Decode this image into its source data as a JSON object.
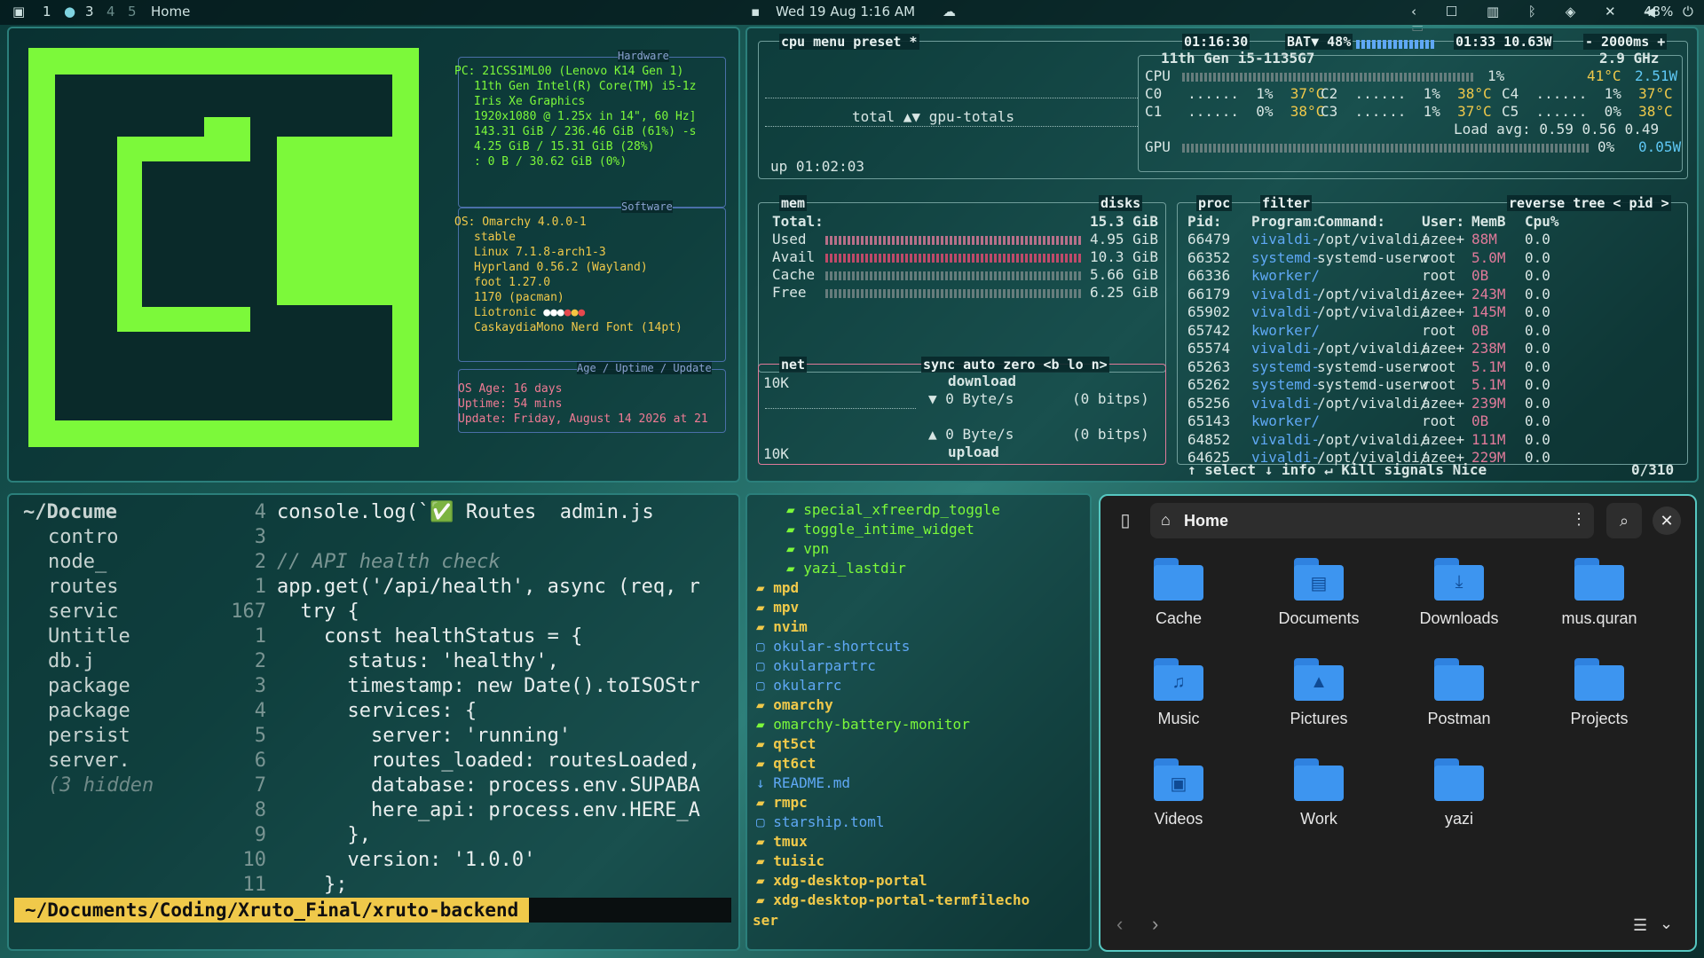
{
  "topbar": {
    "workspaces": [
      "1",
      "2",
      "3",
      "4",
      "5"
    ],
    "active_label": "Home",
    "clock": "Wed 19 Aug 1:16 AM",
    "battery": "48%"
  },
  "fetch": {
    "hardware_title": "Hardware",
    "hardware": [
      "PC: 21CSS1ML00 (Lenovo K14 Gen 1)",
      "11th Gen Intel(R) Core(TM) i5-1z",
      "Iris Xe Graphics",
      "1920x1080 @ 1.25x in 14\", 60 Hz]",
      "143.31 GiB / 236.46 GiB (61%) -s",
      "4.25 GiB / 15.31 GiB (28%)",
      ": 0 B / 30.62 GiB (0%)"
    ],
    "software_title": "Software",
    "software": [
      "OS: Omarchy 4.0.0-1",
      "stable",
      "Linux 7.1.8-arch1-3",
      "Hyprland 0.56.2 (Wayland)",
      "foot 1.27.0",
      "1170 (pacman)",
      "Liotronic",
      "CaskaydiaMono Nerd Font (14pt)"
    ],
    "age_title": "Age / Uptime / Update",
    "age": [
      "OS Age: 16 days",
      "Uptime: 54 mins",
      "Update: Friday, August 14 2026 at 21"
    ]
  },
  "btop": {
    "cpu_tabs": [
      "cpu",
      "menu",
      "preset *"
    ],
    "time": "01:16:30",
    "bat": "BAT▼ 48%",
    "bat_time": "01:33 10.63W",
    "rate": "- 2000ms +",
    "cpu_model": "11th Gen i5-1135G7",
    "cpu_freq": "2.9 GHz",
    "cpu_total": "CPU",
    "cpu_total_pct": "1%",
    "cpu_total_temp": "41°C",
    "cpu_total_w": "2.51W",
    "cores": [
      {
        "n": "C0",
        "p": "1%",
        "t": "37°C"
      },
      {
        "n": "C1",
        "p": "0%",
        "t": "38°C"
      },
      {
        "n": "C2",
        "p": "1%",
        "t": "38°C"
      },
      {
        "n": "C3",
        "p": "1%",
        "t": "37°C"
      },
      {
        "n": "C4",
        "p": "1%",
        "t": "37°C"
      },
      {
        "n": "C5",
        "p": "0%",
        "t": "38°C"
      }
    ],
    "load_avg": "Load avg: 0.59 0.56 0.49",
    "gpu": "GPU",
    "gpu_pct": "0%",
    "gpu_w": "0.05W",
    "totals": "total ▲▼ gpu-totals",
    "uptime": "up 01:02:03",
    "mem_title": "mem",
    "disks_title": "disks",
    "mem": [
      {
        "k": "Total:",
        "v": "15.3 GiB"
      },
      {
        "k": "Used",
        "v": "4.95 GiB"
      },
      {
        "k": "Avail",
        "v": "10.3 GiB"
      },
      {
        "k": "Cache",
        "v": "5.66 GiB"
      },
      {
        "k": "Free",
        "v": "6.25 GiB"
      }
    ],
    "net_title": "net",
    "net_tabs": "sync auto zero <b lo n>",
    "net_scale_top": "10K",
    "net_scale_bot": "10K",
    "download": "download",
    "dl_val": "▼ 0 Byte/s",
    "dl_bits": "(0 bitps)",
    "ul_val": "▲ 0 Byte/s",
    "ul_bits": "(0 bitps)",
    "upload": "upload",
    "proc_title": "proc",
    "proc_tabs": "filter",
    "proc_right": "reverse tree < pid >",
    "proc_header": [
      "Pid:",
      "Program:",
      "Command:",
      "User:",
      "MemB",
      "Cpu%"
    ],
    "procs": [
      [
        "66479",
        "vivaldi-",
        "/opt/vivaldi/",
        "azee+",
        "88M",
        "0.0"
      ],
      [
        "66352",
        "systemd-",
        "systemd-userw",
        "root",
        "5.0M",
        "0.0"
      ],
      [
        "66336",
        "kworker/",
        "",
        "root",
        "0B",
        "0.0"
      ],
      [
        "66179",
        "vivaldi-",
        "/opt/vivaldi/",
        "azee+",
        "243M",
        "0.0"
      ],
      [
        "65902",
        "vivaldi-",
        "/opt/vivaldi/",
        "azee+",
        "145M",
        "0.0"
      ],
      [
        "65742",
        "kworker/",
        "",
        "root",
        "0B",
        "0.0"
      ],
      [
        "65574",
        "vivaldi-",
        "/opt/vivaldi/",
        "azee+",
        "238M",
        "0.0"
      ],
      [
        "65263",
        "systemd-",
        "systemd-userw",
        "root",
        "5.1M",
        "0.0"
      ],
      [
        "65262",
        "systemd-",
        "systemd-userw",
        "root",
        "5.1M",
        "0.0"
      ],
      [
        "65256",
        "vivaldi-",
        "/opt/vivaldi/",
        "azee+",
        "239M",
        "0.0"
      ],
      [
        "65143",
        "kworker/",
        "",
        "root",
        "0B",
        "0.0"
      ],
      [
        "64852",
        "vivaldi-",
        "/opt/vivaldi/",
        "azee+",
        "111M",
        "0.0"
      ],
      [
        "64625",
        "vivaldi-",
        "/opt/vivaldi/",
        "azee+",
        "229M",
        "0.0"
      ]
    ],
    "proc_footer": "↑ select ↓ info ↵ Kill signals Nice",
    "proc_count": "0/310"
  },
  "editor": {
    "tree": [
      "~/Docume",
      "contro",
      "node_",
      "routes",
      "servic",
      "Untitle",
      "db.j",
      "package",
      "package",
      "persist",
      "server.",
      "(3 hidden"
    ],
    "gutter": [
      "4",
      "3",
      "2",
      "1",
      "167",
      "1",
      "2",
      "3",
      "4",
      "5",
      "6",
      "7",
      "8",
      "9",
      "10",
      "11"
    ],
    "lines": [
      "console.log(`✅ Routes  admin.js",
      "",
      "// API health check",
      "app.get('/api/health', async (req, r",
      "  try {",
      "    const healthStatus = {",
      "      status: 'healthy',",
      "      timestamp: new Date().toISOStr",
      "      services: {",
      "        server: 'running'",
      "        routes_loaded: routesLoaded,",
      "        database: process.env.SUPABA",
      "        here_api: process.env.HERE_A",
      "      },",
      "      version: '1.0.0'",
      "    };"
    ],
    "status_path": "~/Documents/Coding/Xruto_Final/xruto-backend"
  },
  "filetree": {
    "items": [
      "special_xfreerdp_toggle",
      "toggle_intime_widget",
      "vpn",
      "yazi_lastdir",
      "mpd",
      "mpv",
      "nvim",
      "okular-shortcuts",
      "okularpartrc",
      "okularrc",
      "omarchy",
      "omarchy-battery-monitor",
      "qt5ct",
      "qt6ct",
      "README.md",
      "rmpc",
      "starship.toml",
      "tmux",
      "tuisic",
      "xdg-desktop-portal",
      "xdg-desktop-portal-termfilecho"
    ],
    "prompt": "ser"
  },
  "files": {
    "title": "Home",
    "folders": [
      {
        "name": "Cache",
        "icon": ""
      },
      {
        "name": "Documents",
        "icon": "▤"
      },
      {
        "name": "Downloads",
        "icon": "⤓"
      },
      {
        "name": "mus.quran",
        "icon": ""
      },
      {
        "name": "Music",
        "icon": "♫"
      },
      {
        "name": "Pictures",
        "icon": "▲"
      },
      {
        "name": "Postman",
        "icon": ""
      },
      {
        "name": "Projects",
        "icon": ""
      },
      {
        "name": "Videos",
        "icon": "▣"
      },
      {
        "name": "Work",
        "icon": ""
      },
      {
        "name": "yazi",
        "icon": ""
      }
    ]
  },
  "colors": {
    "accent": "#7cf93a",
    "border": "#2b7f7b",
    "folder": "#3d95f0"
  }
}
